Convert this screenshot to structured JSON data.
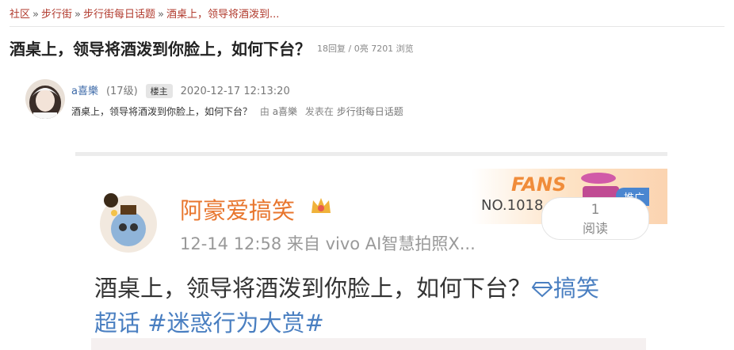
{
  "breadcrumb": {
    "items": [
      "社区",
      "步行街",
      "步行街每日话题",
      "酒桌上，领导将酒泼到..."
    ],
    "separator": "»"
  },
  "thread": {
    "title": "酒桌上，领导将酒泼到你脸上，如何下台？",
    "stats": "18回复 / 0亮 7201 浏览"
  },
  "post": {
    "username": "a喜樂",
    "level": "(17级)",
    "badge": "楼主",
    "date": "2020-12-17 12:13:20",
    "text": "酒桌上，领导将酒泼到你脸上，如何下台？",
    "by_prefix": "由",
    "by_user": "a喜樂",
    "posted_in": "发表在",
    "board": "步行街每日话题"
  },
  "weibo": {
    "username": "阿豪爱搞笑",
    "time": "12-14 12:58",
    "source": "来自 vivo AI智慧拍照X...",
    "fans_label": "FANS",
    "fans_no": "NO.1018",
    "promo": "推广",
    "read_count": "1",
    "read_label": "阅读",
    "body_text": "酒桌上，领导将酒泼到你脸上，如何下台？",
    "topic1": "搞笑",
    "topic1_line2": "超话",
    "topic2": "#迷惑行为大赏#"
  },
  "colors": {
    "breadcrumb_link": "#b13a2d",
    "username_link": "#3d6aa8",
    "weibo_name": "#e8762e",
    "weibo_topic": "#4a7fc1"
  }
}
